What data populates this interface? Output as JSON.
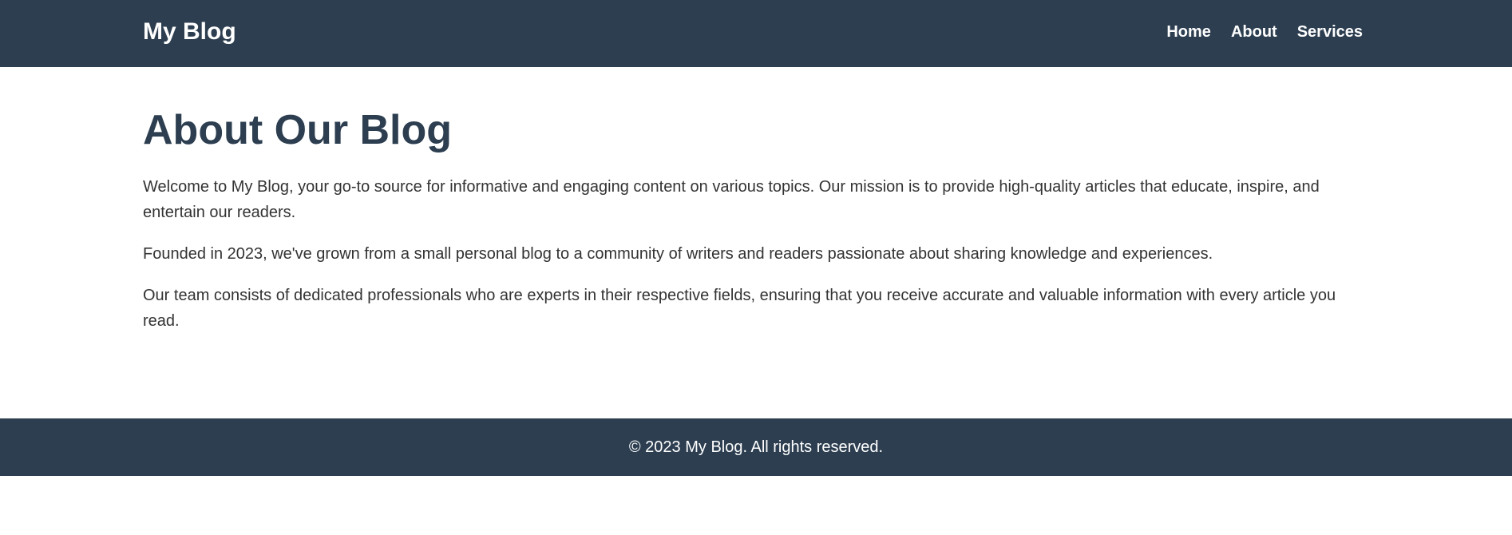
{
  "header": {
    "brand": "My Blog",
    "nav": [
      "Home",
      "About",
      "Services"
    ]
  },
  "main": {
    "title": "About Our Blog",
    "paragraphs": [
      "Welcome to My Blog, your go-to source for informative and engaging content on various topics. Our mission is to provide high-quality articles that educate, inspire, and entertain our readers.",
      "Founded in 2023, we've grown from a small personal blog to a community of writers and readers passionate about sharing knowledge and experiences.",
      "Our team consists of dedicated professionals who are experts in their respective fields, ensuring that you receive accurate and valuable information with every article you read."
    ]
  },
  "footer": {
    "text": "© 2023 My Blog. All rights reserved."
  },
  "colors": {
    "header_bg": "#2c3e50",
    "title": "#2c3e50",
    "body_text": "#333333",
    "footer_bg": "#2c3e50"
  }
}
